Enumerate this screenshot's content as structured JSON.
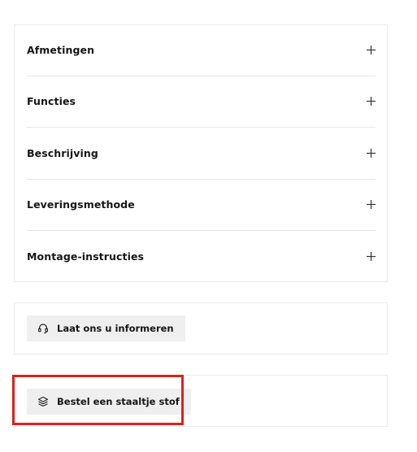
{
  "accordion": {
    "items": [
      {
        "label": "Afmetingen",
        "icon": "plus-icon"
      },
      {
        "label": "Functies",
        "icon": "plus-icon"
      },
      {
        "label": "Beschrijving",
        "icon": "plus-icon"
      },
      {
        "label": "Leveringsmethode",
        "icon": "plus-icon"
      },
      {
        "label": "Montage-instructies",
        "icon": "plus-icon"
      }
    ]
  },
  "actions": {
    "inform": {
      "label": "Laat ons u informeren",
      "icon": "headset-icon"
    },
    "sample": {
      "label": "Bestel een staaltje stof",
      "icon": "layers-icon"
    }
  },
  "colors": {
    "highlight": "#d9231f",
    "button_bg": "#efefef",
    "border": "#ebebeb"
  }
}
